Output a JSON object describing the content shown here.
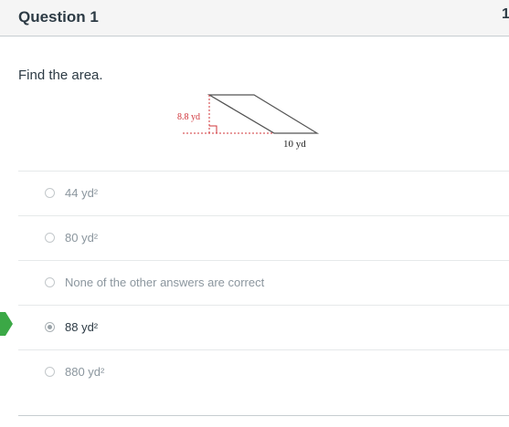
{
  "question": {
    "title": "Question 1",
    "points_partial": "1",
    "prompt": "Find the area.",
    "figure": {
      "height_label": "8.8 yd",
      "base_label": "10 yd"
    }
  },
  "answers": [
    {
      "label": "44 yd²",
      "selected": false
    },
    {
      "label": "80 yd²",
      "selected": false
    },
    {
      "label": "None of the other answers are correct",
      "selected": false
    },
    {
      "label": "88 yd²",
      "selected": true
    },
    {
      "label": "880 yd²",
      "selected": false
    }
  ],
  "colors": {
    "correct_marker": "#3ba846",
    "dimension_red": "#d0343a"
  }
}
